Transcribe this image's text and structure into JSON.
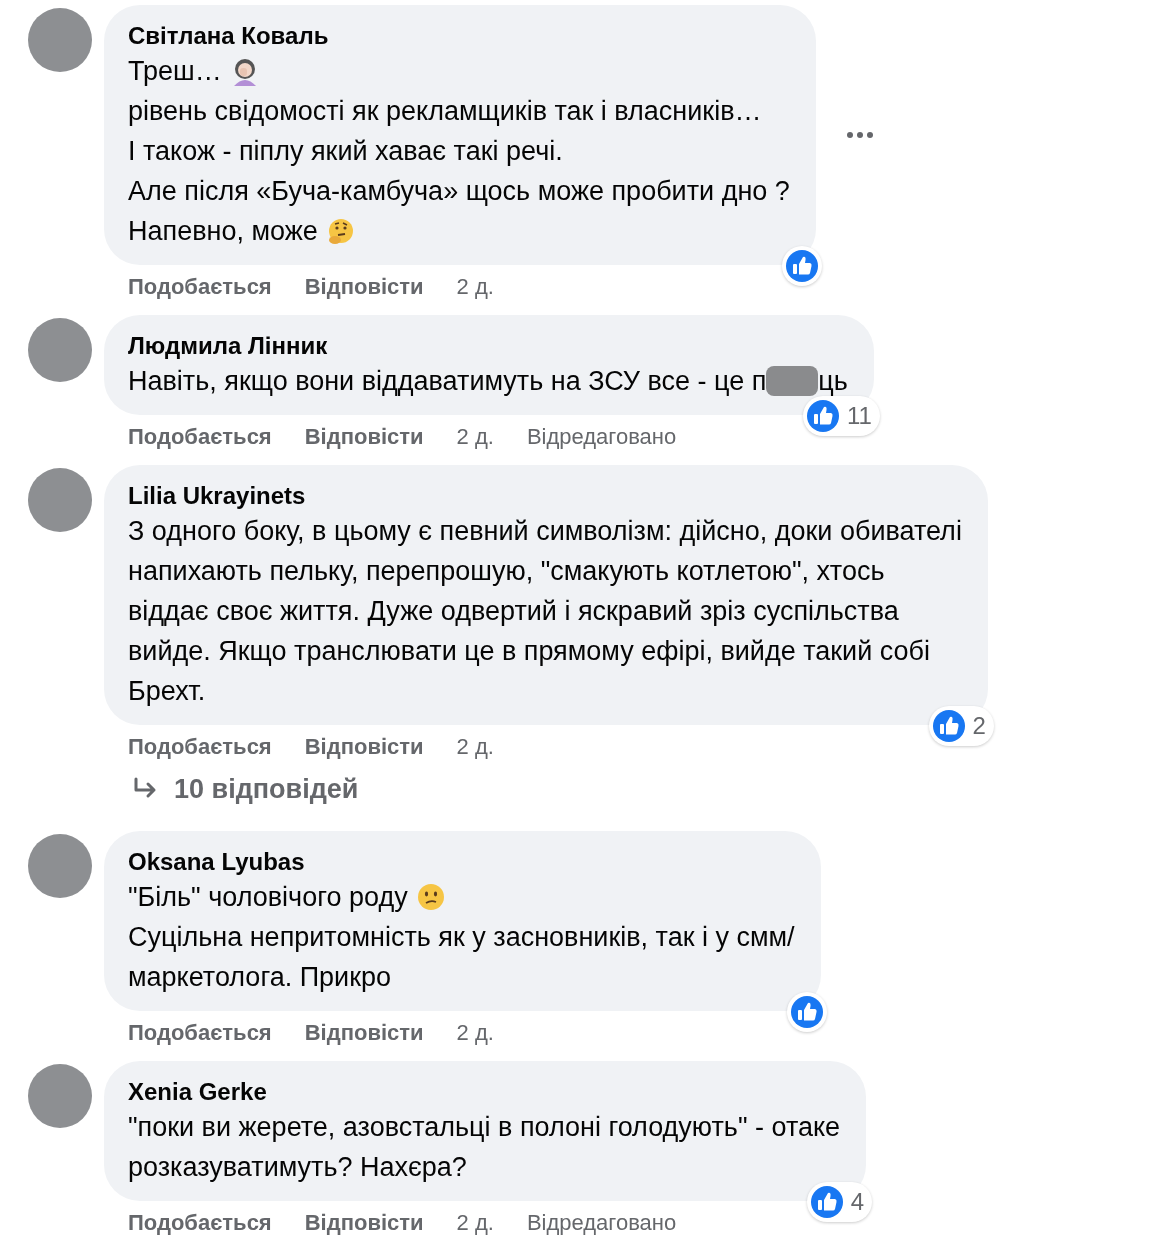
{
  "comments": [
    {
      "author": "Світлана Коваль",
      "lines": [
        [
          {
            "kind": "text",
            "text": "Треш…"
          },
          {
            "kind": "facepalm"
          }
        ],
        [
          {
            "kind": "text",
            "text": "рівень свідомості як рекламщиків так і власників…"
          }
        ],
        [
          {
            "kind": "text",
            "text": "І також - піплу який хаває такі речі."
          }
        ],
        [
          {
            "kind": "text",
            "text": "Але після «Буча-камбуча» щось може пробити дно ?"
          }
        ],
        [
          {
            "kind": "text",
            "text": "Напевно, може"
          },
          {
            "kind": "thinking"
          }
        ]
      ],
      "more_button": true,
      "reaction": {
        "kind": "like"
      },
      "actions": {
        "like": "Подобається",
        "reply": "Відповісти",
        "time": "2 д."
      }
    },
    {
      "author": "Людмила Лінник",
      "lines": [
        [
          {
            "kind": "text",
            "text": "Навіть, якщо вони віддаватимуть на ЗСУ все - це п"
          },
          {
            "kind": "censor"
          },
          {
            "kind": "text",
            "text": "ць"
          }
        ]
      ],
      "more_button": false,
      "reaction": {
        "kind": "like",
        "count": "11"
      },
      "actions": {
        "like": "Подобається",
        "reply": "Відповісти",
        "time": "2 д.",
        "edited": "Відредаговано"
      }
    },
    {
      "author": "Lilia Ukrayinets",
      "lines": [
        [
          {
            "kind": "text",
            "text": "З одного боку, в цьому є певний символізм: дійсно, доки обивателі"
          }
        ],
        [
          {
            "kind": "text",
            "text": "напихають пельку, перепрошую, \"смакують котлетою\", хтось"
          }
        ],
        [
          {
            "kind": "text",
            "text": "віддає своє життя. Дуже одвертий і яскравий зріз суспільства"
          }
        ],
        [
          {
            "kind": "text",
            "text": "вийде. Якщо транслювати це в прямому ефірі, вийде такий собі"
          }
        ],
        [
          {
            "kind": "text",
            "text": "Брехт."
          }
        ]
      ],
      "more_button": false,
      "reaction": {
        "kind": "like",
        "count": "2"
      },
      "actions": {
        "like": "Подобається",
        "reply": "Відповісти",
        "time": "2 д."
      },
      "replies": "10 відповідей"
    },
    {
      "author": "Oksana Lyubas",
      "lines": [
        [
          {
            "kind": "text",
            "text": "\"Біль\" чоловічого роду"
          },
          {
            "kind": "confused"
          }
        ],
        [
          {
            "kind": "text",
            "text": "Суцільна непритомність як у засновників, так і у смм/"
          }
        ],
        [
          {
            "kind": "text",
            "text": "маркетолога. Прикро"
          }
        ]
      ],
      "more_button": false,
      "reaction": {
        "kind": "like"
      },
      "actions": {
        "like": "Подобається",
        "reply": "Відповісти",
        "time": "2 д."
      }
    },
    {
      "author": "Xenia Gerke",
      "lines": [
        [
          {
            "kind": "text",
            "text": "\"поки ви жерете, азовстальці в полоні голодують\" - отаке"
          }
        ],
        [
          {
            "kind": "text",
            "text": "розказуватимуть? Нахєра?"
          }
        ]
      ],
      "more_button": false,
      "reaction": {
        "kind": "like",
        "count": "4"
      },
      "actions": {
        "like": "Подобається",
        "reply": "Відповісти",
        "time": "2 д.",
        "edited": "Відредаговано"
      }
    }
  ]
}
